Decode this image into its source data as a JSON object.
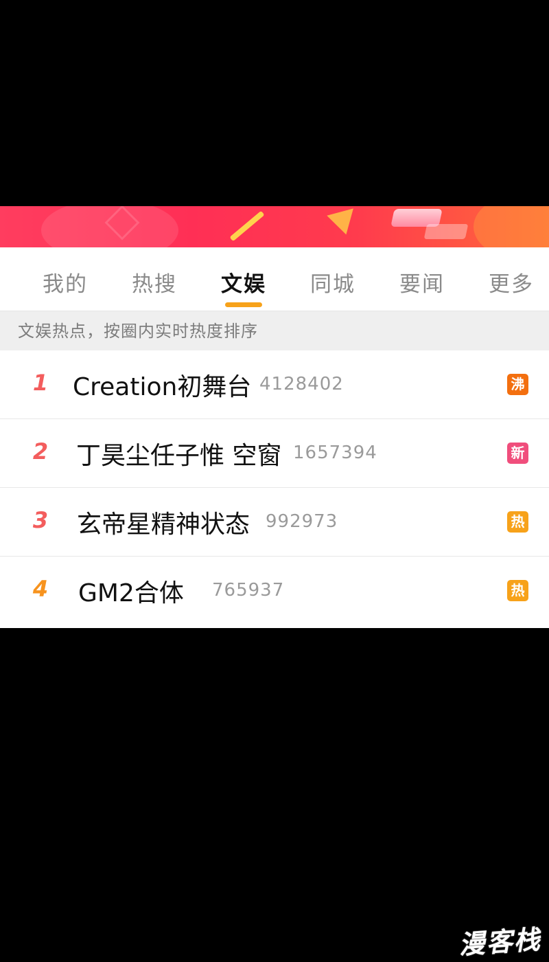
{
  "tabs": [
    {
      "label": "我的",
      "active": false
    },
    {
      "label": "热搜",
      "active": false
    },
    {
      "label": "文娱",
      "active": true
    },
    {
      "label": "同城",
      "active": false
    },
    {
      "label": "要闻",
      "active": false
    },
    {
      "label": "更多",
      "active": false
    }
  ],
  "subheader": "文娱热点，按圈内实时热度排序",
  "colors": {
    "accent": "#f7a21a",
    "rank_red": "#f35d5d",
    "rank_orange": "#f7931e",
    "badge_boil": "#f36f0f",
    "badge_new": "#f04e7c",
    "badge_hot": "#f7a21a"
  },
  "items": [
    {
      "rank": "1",
      "title": "Creation初舞台",
      "count": "4128402",
      "badge": "沸"
    },
    {
      "rank": "2",
      "title": "丁昊尘任子惟 空窗",
      "count": "1657394",
      "badge": "新"
    },
    {
      "rank": "3",
      "title": "玄帝星精神状态",
      "count": "992973",
      "badge": "热"
    },
    {
      "rank": "4",
      "title": "GM2合体",
      "count": "765937",
      "badge": "热"
    }
  ],
  "watermark": "漫客栈"
}
